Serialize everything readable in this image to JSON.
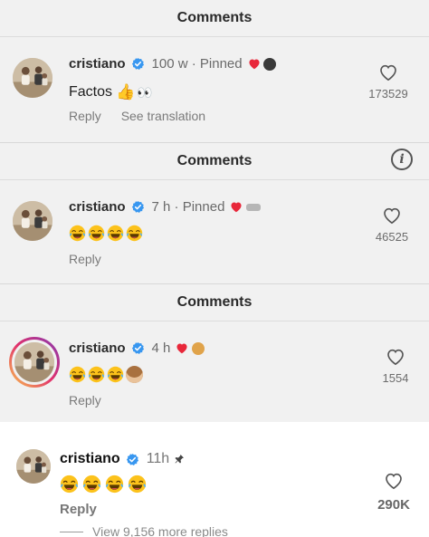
{
  "panels": [
    {
      "header": "Comments",
      "username": "cristiano",
      "meta": "100 w · Pinned",
      "text": "Factos",
      "actions": [
        "Reply",
        "See translation"
      ],
      "likes": "173529"
    },
    {
      "header": "Comments",
      "username": "cristiano",
      "meta": "7 h · Pinned",
      "text": "",
      "actions": [
        "Reply"
      ],
      "likes": "46525"
    },
    {
      "header": "Comments",
      "username": "cristiano",
      "meta": "4 h",
      "text": "",
      "actions": [
        "Reply"
      ],
      "likes": "1554"
    }
  ],
  "latest": {
    "username": "cristiano",
    "meta": "11h",
    "reply": "Reply",
    "likes": "290K",
    "view_replies": "View 9,156 more replies"
  },
  "colors": {
    "verified": "#3897f0",
    "heart_red": "#e8273a",
    "panel_bg": "#f1f1f1"
  },
  "icons": [
    "verified-badge-icon",
    "red-heart-icon",
    "pin-icon",
    "heart-outline-icon",
    "info-icon",
    "laughing-emoji",
    "thumbs-up-emoji",
    "eyes-emoji",
    "monkey-emoji"
  ]
}
